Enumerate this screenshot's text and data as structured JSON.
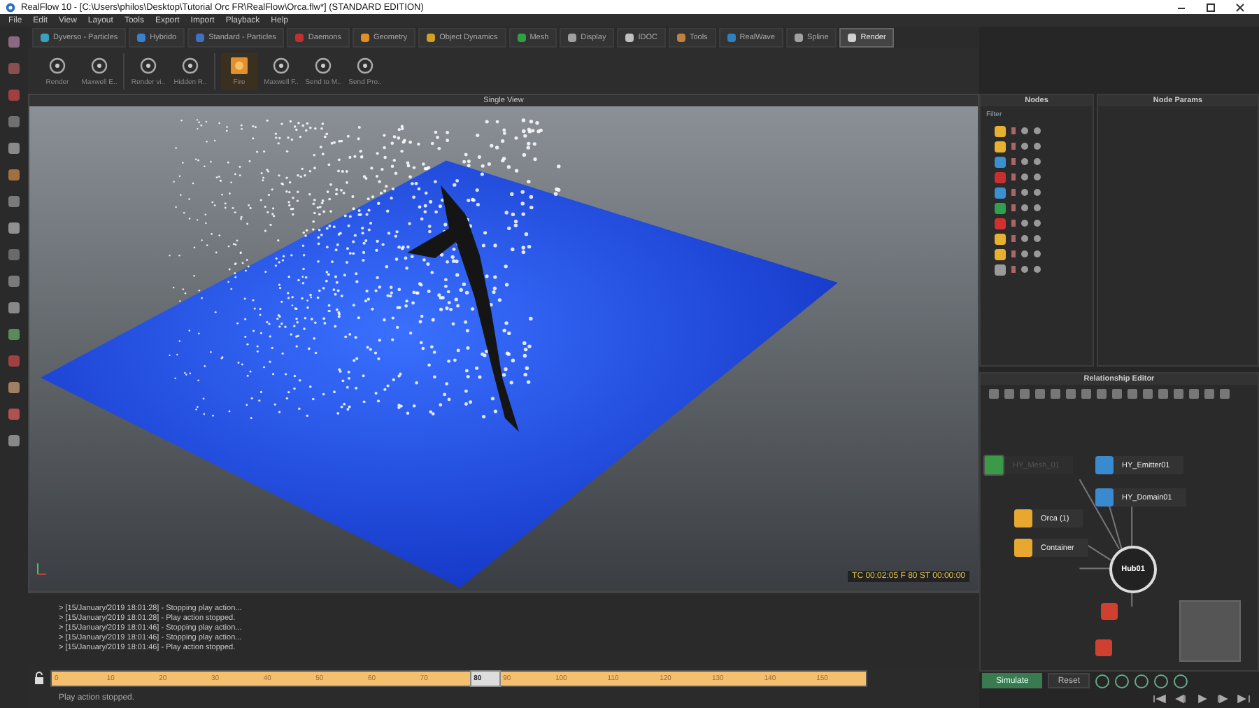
{
  "window": {
    "title": "RealFlow 10 - [C:\\Users\\philos\\Desktop\\Tutorial Orc FR\\RealFlow\\Orca.flw*] (STANDARD EDITION)"
  },
  "menu": [
    "File",
    "Edit",
    "View",
    "Layout",
    "Tools",
    "Export",
    "Import",
    "Playback",
    "Help"
  ],
  "tabs": [
    {
      "label": "Dyverso - Particles",
      "selected": false,
      "color": "#3aa0c0"
    },
    {
      "label": "Hybrido",
      "selected": false,
      "color": "#3a80d0"
    },
    {
      "label": "Standard - Particles",
      "selected": false,
      "color": "#4070c0"
    },
    {
      "label": "Daemons",
      "selected": false,
      "color": "#c03030"
    },
    {
      "label": "Geometry",
      "selected": false,
      "color": "#e09020"
    },
    {
      "label": "Object Dynamics",
      "selected": false,
      "color": "#d0a020"
    },
    {
      "label": "Mesh",
      "selected": false,
      "color": "#30a040"
    },
    {
      "label": "Display",
      "selected": false,
      "color": "#a0a0a0"
    },
    {
      "label": "IDOC",
      "selected": false,
      "color": "#c0c0c0"
    },
    {
      "label": "Tools",
      "selected": false,
      "color": "#c08040"
    },
    {
      "label": "RealWave",
      "selected": false,
      "color": "#3080c0"
    },
    {
      "label": "Spline",
      "selected": false,
      "color": "#a0a0a0"
    },
    {
      "label": "Render",
      "selected": true,
      "color": "#d0d0d0"
    }
  ],
  "toolbar": [
    {
      "label": "Render",
      "highlighted": false
    },
    {
      "label": "Maxwell E..",
      "highlighted": false
    },
    {
      "label": "Render vi..",
      "highlighted": false
    },
    {
      "label": "Hidden R..",
      "highlighted": false
    },
    {
      "label": "Fire",
      "highlighted": true
    },
    {
      "label": "Maxwell F..",
      "highlighted": false
    },
    {
      "label": "Send to M..",
      "highlighted": false
    },
    {
      "label": "Send Pro..",
      "highlighted": false
    }
  ],
  "viewport": {
    "title": "Single View",
    "readout": "TC 00:02:05   F 80   ST 00:00:00"
  },
  "console": [
    "> [15/January/2019 18:01:28] - Stopping play action...",
    "> [15/January/2019 18:01:28] - Play action stopped.",
    "> [15/January/2019 18:01:46] - Stopping play action...",
    "> [15/January/2019 18:01:46] - Stopping play action...",
    "> [15/January/2019 18:01:46] - Play action stopped."
  ],
  "timeline": [
    {
      "label": "0",
      "selected": false
    },
    {
      "label": "10",
      "selected": false
    },
    {
      "label": "20",
      "selected": false
    },
    {
      "label": "30",
      "selected": false
    },
    {
      "label": "40",
      "selected": false
    },
    {
      "label": "50",
      "selected": false
    },
    {
      "label": "60",
      "selected": false
    },
    {
      "label": "70",
      "selected": false
    },
    {
      "label": "80",
      "selected": true
    },
    {
      "label": "90",
      "selected": false
    },
    {
      "label": "100",
      "selected": false
    },
    {
      "label": "110",
      "selected": false
    },
    {
      "label": "120",
      "selected": false
    },
    {
      "label": "130",
      "selected": false
    },
    {
      "label": "140",
      "selected": false
    },
    {
      "label": "150",
      "selected": false
    }
  ],
  "status_bar": "Play action stopped.",
  "nodes_panel": {
    "title": "Nodes",
    "filter": "Filter",
    "items": [
      {
        "color": "#e8b030"
      },
      {
        "color": "#e8b030"
      },
      {
        "color": "#3a90d0"
      },
      {
        "color": "#c83030"
      },
      {
        "color": "#3a90d0"
      },
      {
        "color": "#30a050"
      },
      {
        "color": "#d03030"
      },
      {
        "color": "#e8b030"
      },
      {
        "color": "#e8b030"
      },
      {
        "color": "#9a9a9a"
      }
    ]
  },
  "params_panel": {
    "title": "Node Params"
  },
  "relationship_editor": {
    "title": "Relationship Editor",
    "nodes": [
      {
        "label": "HY_Mesh_01",
        "color": "#3a9a48",
        "disabled": true
      },
      {
        "label": "HY_Emitter01",
        "color": "#3a8ad0",
        "disabled": false
      },
      {
        "label": "HY_Domain01",
        "color": "#3a8ad0",
        "disabled": false
      },
      {
        "label": "Orca (1)",
        "color": "#e8a830",
        "disabled": false
      },
      {
        "label": "Container",
        "color": "#e8a830",
        "disabled": false
      }
    ],
    "hub": "Hub01"
  },
  "controls": {
    "simulate": "Simulate",
    "reset": "Reset"
  }
}
